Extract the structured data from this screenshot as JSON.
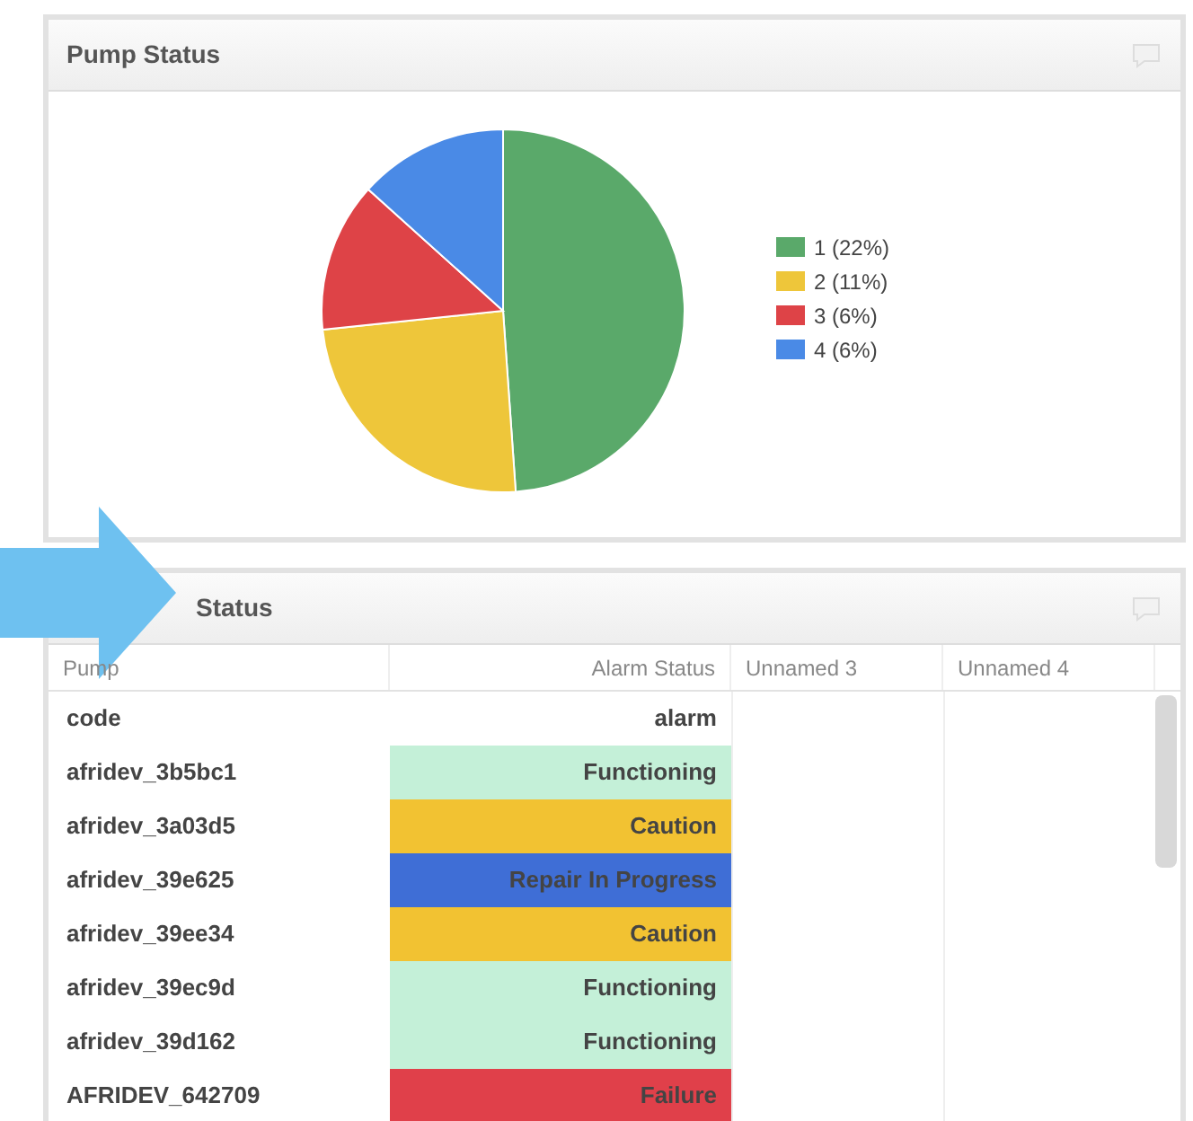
{
  "panels": [
    {
      "title": "Pump Status",
      "chart_data": {
        "type": "pie",
        "categories": [
          "1 (22%)",
          "2 (11%)",
          "3 (6%)",
          "4 (6%)"
        ],
        "values": [
          22,
          11,
          6,
          6
        ],
        "legend": "right",
        "colors": [
          "#5aa96a",
          "#eec63a",
          "#de4347",
          "#4a8ae6"
        ]
      }
    },
    {
      "title": "Status",
      "table": {
        "columns": [
          "Pump",
          "Alarm Status",
          "Unnamed 3",
          "Unnamed 4"
        ],
        "rows": [
          {
            "pump": "code",
            "alarm": "alarm"
          },
          {
            "pump": "afridev_3b5bc1",
            "alarm": "Functioning",
            "color": "#c4f0d8"
          },
          {
            "pump": "afridev_3a03d5",
            "alarm": "Caution",
            "color": "#f2c232"
          },
          {
            "pump": "afridev_39e625",
            "alarm": "Repair In Progress",
            "color": "#3f6ed6"
          },
          {
            "pump": "afridev_39ee34",
            "alarm": "Caution",
            "color": "#f2c232"
          },
          {
            "pump": "afridev_39ec9d",
            "alarm": "Functioning",
            "color": "#c4f0d8"
          },
          {
            "pump": "afridev_39d162",
            "alarm": "Functioning",
            "color": "#c4f0d8"
          },
          {
            "pump": "AFRIDEV_642709",
            "alarm": "Failure",
            "color": "#e0404a"
          }
        ]
      }
    }
  ]
}
